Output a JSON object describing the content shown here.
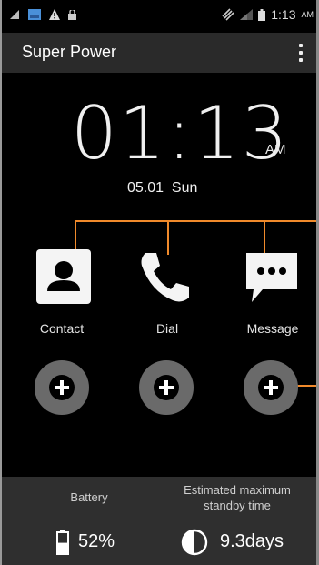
{
  "status_bar": {
    "time": "1:13",
    "ampm": "AM",
    "icons": [
      "signal-bars-icon",
      "image-icon",
      "warning-icon",
      "lock-icon",
      "vibrate-icon",
      "mobile-signal-icon",
      "battery-icon"
    ]
  },
  "action_bar": {
    "title": "Super Power",
    "menu_icon": "overflow-menu-icon"
  },
  "clock": {
    "time": "01:13",
    "ampm": "AM",
    "date": "05.01  Sun"
  },
  "apps": [
    {
      "label": "Contact",
      "icon": "contact-icon"
    },
    {
      "label": "Dial",
      "icon": "phone-icon"
    },
    {
      "label": "Message",
      "icon": "message-icon"
    }
  ],
  "add_buttons": [
    {
      "icon": "plus-icon"
    },
    {
      "icon": "plus-icon"
    },
    {
      "icon": "plus-icon"
    }
  ],
  "footer": {
    "battery_label": "Battery",
    "battery_value": "52%",
    "battery_level": 0.52,
    "standby_label_line1": "Estimated maximum",
    "standby_label_line2": "standby time",
    "standby_value": "9.3days"
  },
  "colors": {
    "callout": "#f08a2b",
    "action_bar": "#2a2a2a",
    "footer": "#2f2f2f",
    "plus_button": "#6a6a6a"
  }
}
